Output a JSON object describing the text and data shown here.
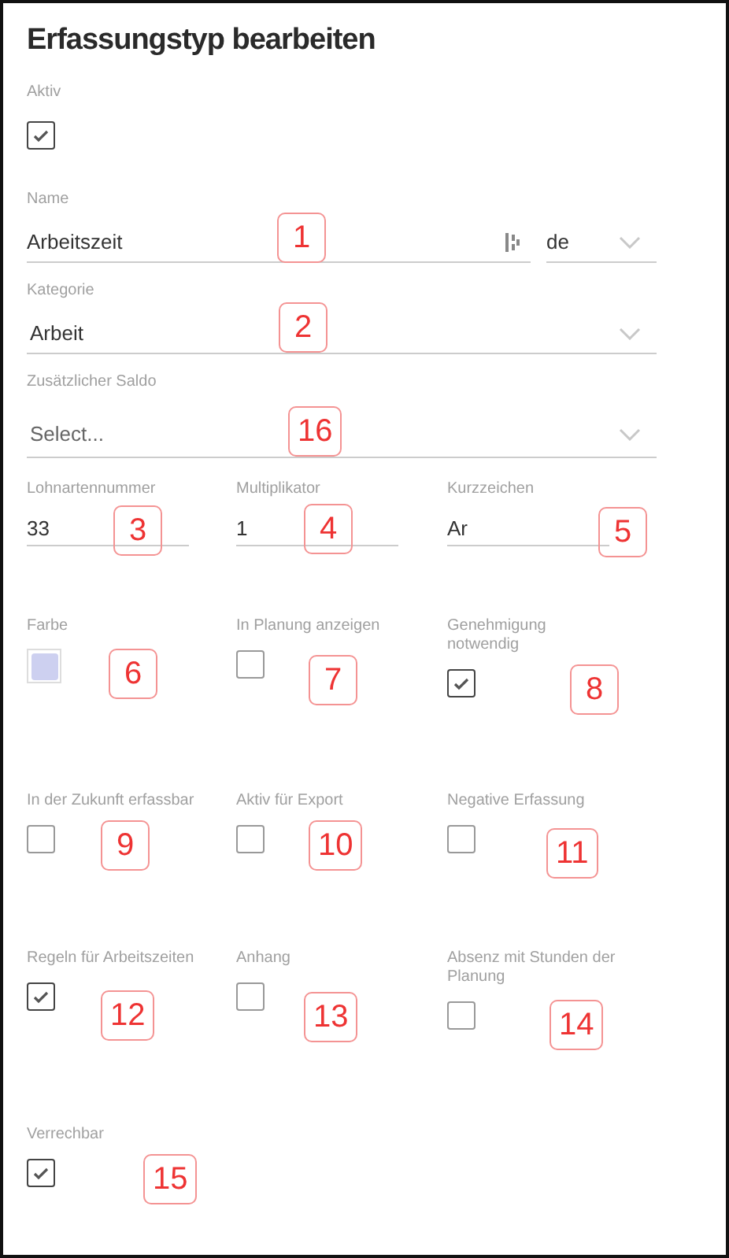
{
  "title": "Erfassungstyp bearbeiten",
  "aktiv": {
    "label": "Aktiv",
    "checked": true
  },
  "name": {
    "label": "Name",
    "value": "Arbeitszeit",
    "callout": "1",
    "language": "de"
  },
  "kategorie": {
    "label": "Kategorie",
    "value": "Arbeit",
    "callout": "2"
  },
  "saldo": {
    "label": "Zusätzlicher Saldo",
    "placeholder": "Select...",
    "callout": "16"
  },
  "grid": [
    {
      "kind": "text",
      "label": "Lohnartennummer",
      "value": "33",
      "callout": "3"
    },
    {
      "kind": "text",
      "label": "Multiplikator",
      "value": "1",
      "callout": "4"
    },
    {
      "kind": "text",
      "label": "Kurzzeichen",
      "value": "Ar",
      "callout": "5"
    },
    {
      "kind": "color",
      "label": "Farbe",
      "color": "#cdd0f0",
      "callout": "6"
    },
    {
      "kind": "checkbox",
      "label": "In Planung anzeigen",
      "checked": false,
      "callout": "7"
    },
    {
      "kind": "checkbox",
      "label": "Genehmigung notwendig",
      "checked": true,
      "callout": "8"
    },
    {
      "kind": "checkbox",
      "label": "In der Zukunft erfassbar",
      "checked": false,
      "callout": "9"
    },
    {
      "kind": "checkbox",
      "label": "Aktiv für Export",
      "checked": false,
      "callout": "10"
    },
    {
      "kind": "checkbox",
      "label": "Negative Erfassung",
      "checked": false,
      "callout": "11"
    },
    {
      "kind": "checkbox",
      "label": "Regeln für Arbeitszeiten",
      "checked": true,
      "callout": "12"
    },
    {
      "kind": "checkbox",
      "label": "Anhang",
      "checked": false,
      "callout": "13"
    },
    {
      "kind": "checkbox",
      "label": "Absenz mit Stunden der Planung",
      "checked": false,
      "callout": "14"
    },
    {
      "kind": "checkbox",
      "label": "Verrechbar",
      "checked": true,
      "callout": "15"
    }
  ]
}
